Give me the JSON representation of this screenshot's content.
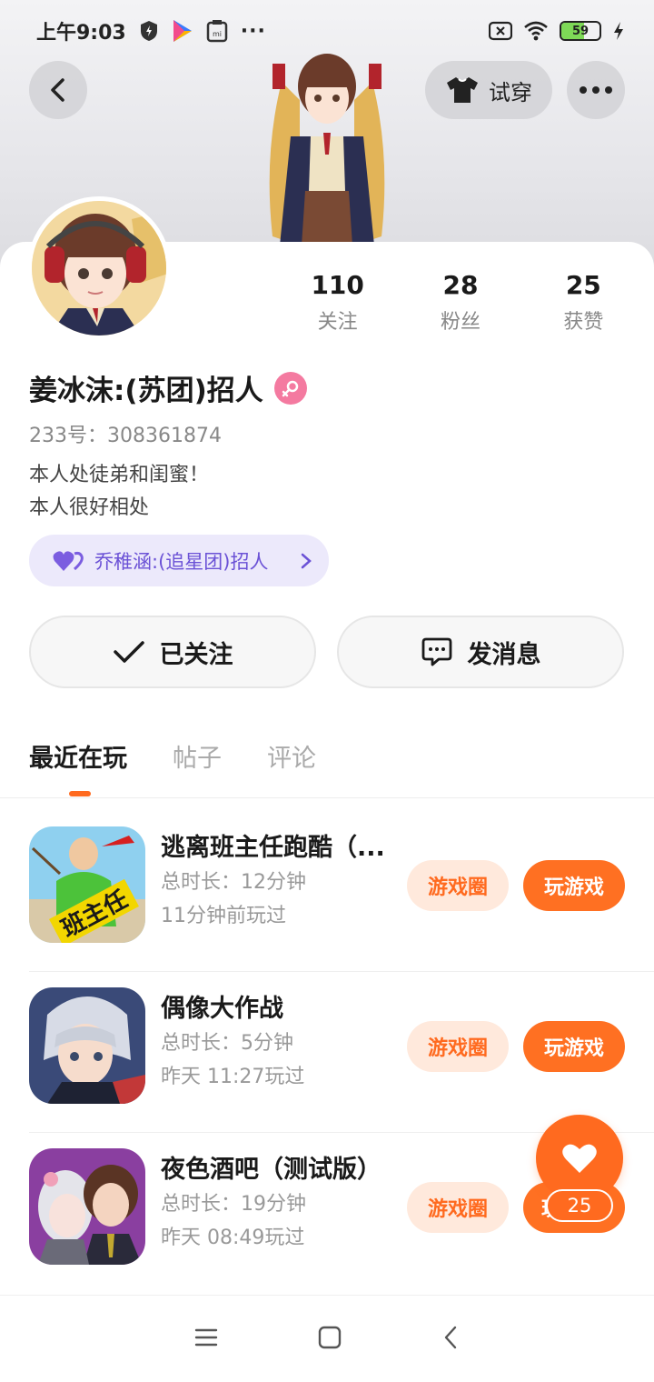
{
  "status_bar": {
    "time": "上午9:03",
    "more": "···",
    "battery_level": 59,
    "battery_text": "59"
  },
  "header": {
    "try_on_label": "试穿"
  },
  "stats": [
    {
      "value": "110",
      "label": "关注"
    },
    {
      "value": "28",
      "label": "粉丝"
    },
    {
      "value": "25",
      "label": "获赞"
    }
  ],
  "profile": {
    "name": "姜冰沫:(苏团)招人",
    "uid": "233号：308361874",
    "bio_line1": "本人处徒弟和闺蜜！",
    "bio_line2": "本人很好相处",
    "relation_label": "乔稚涵:(追星团)招人"
  },
  "actions": {
    "following_label": "已关注",
    "message_label": "发消息"
  },
  "tabs": [
    {
      "label": "最近在玩",
      "active": true
    },
    {
      "label": "帖子",
      "active": false
    },
    {
      "label": "评论",
      "active": false
    }
  ],
  "games": [
    {
      "title": "逃离班主任跑酷（...",
      "duration": "总时长：12分钟",
      "last_played": "11分钟前玩过",
      "circle_label": "游戏圈",
      "play_label": "玩游戏"
    },
    {
      "title": "偶像大作战",
      "duration": "总时长：5分钟",
      "last_played": "昨天 11:27玩过",
      "circle_label": "游戏圈",
      "play_label": "玩游戏"
    },
    {
      "title": "夜色酒吧（测试版）",
      "duration": "总时长：19分钟",
      "last_played": "昨天 08:49玩过",
      "circle_label": "游戏圈",
      "play_label": "玩"
    }
  ],
  "game1_icon_text": "班主任",
  "fab": {
    "count": "25"
  },
  "colors": {
    "accent": "#ff6a1f",
    "relation_bg": "#ece9fb",
    "relation_text": "#6b52d6",
    "gender_badge": "#f47aa0"
  }
}
